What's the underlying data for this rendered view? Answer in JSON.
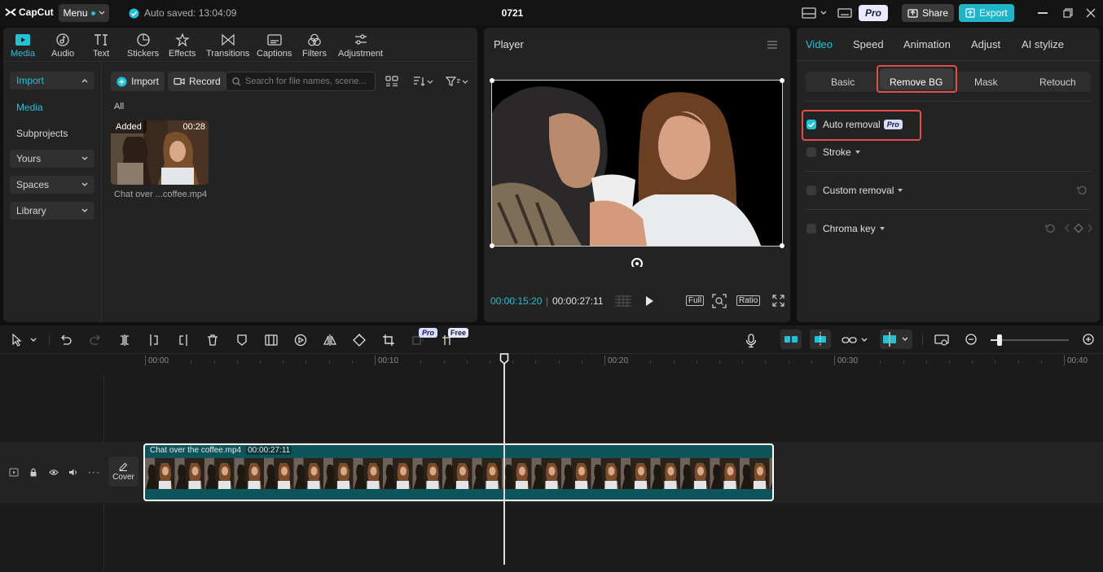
{
  "titlebar": {
    "logo": "CapCut",
    "menu_label": "Menu",
    "autosave_text": "Auto saved: 13:04:09",
    "project_title": "0721",
    "pro_label": "Pro",
    "share_label": "Share",
    "export_label": "Export"
  },
  "media": {
    "tabs": [
      {
        "label": "Media",
        "icon": "media-icon",
        "active": true
      },
      {
        "label": "Audio",
        "icon": "audio-icon"
      },
      {
        "label": "Text",
        "icon": "text-icon"
      },
      {
        "label": "Stickers",
        "icon": "stickers-icon"
      },
      {
        "label": "Effects",
        "icon": "effects-icon"
      },
      {
        "label": "Transitions",
        "icon": "transitions-icon"
      },
      {
        "label": "Captions",
        "icon": "captions-icon"
      },
      {
        "label": "Filters",
        "icon": "filters-icon"
      },
      {
        "label": "Adjustment",
        "icon": "adjustment-icon"
      }
    ],
    "sidebar": {
      "import": "Import",
      "media": "Media",
      "subprojects": "Subprojects",
      "yours": "Yours",
      "spaces": "Spaces",
      "library": "Library"
    },
    "toolbar": {
      "import_label": "Import",
      "record_label": "Record",
      "search_placeholder": "Search for file names, scene..."
    },
    "filter_all": "All",
    "clip": {
      "badge": "Added",
      "duration": "00:28",
      "name": "Chat over ...coffee.mp4"
    }
  },
  "player": {
    "title": "Player",
    "current_time": "00:00:15:20",
    "total_time": "00:00:27:11",
    "full_label": "Full",
    "ratio_label": "Ratio"
  },
  "inspector": {
    "tabs": [
      "Video",
      "Speed",
      "Animation",
      "Adjust",
      "AI stylize"
    ],
    "active_tab": "Video",
    "subtabs": [
      "Basic",
      "Remove BG",
      "Mask",
      "Retouch"
    ],
    "active_subtab": "Remove BG",
    "options": {
      "auto_removal": "Auto removal",
      "auto_removal_badge": "Pro",
      "stroke": "Stroke",
      "custom_removal": "Custom removal",
      "chroma_key": "Chroma key"
    }
  },
  "timeline": {
    "badge_pro": "Pro",
    "badge_free": "Free",
    "ruler": [
      "00:00",
      "00:10",
      "00:20",
      "00:30",
      "00:40"
    ],
    "cover_label": "Cover",
    "clip_name": "Chat over the coffee.mp4",
    "clip_duration": "00:00:27:11"
  },
  "colors": {
    "accent": "#1fc2d6",
    "clip_bg": "#0e555b",
    "highlight": "#e84b4b"
  }
}
